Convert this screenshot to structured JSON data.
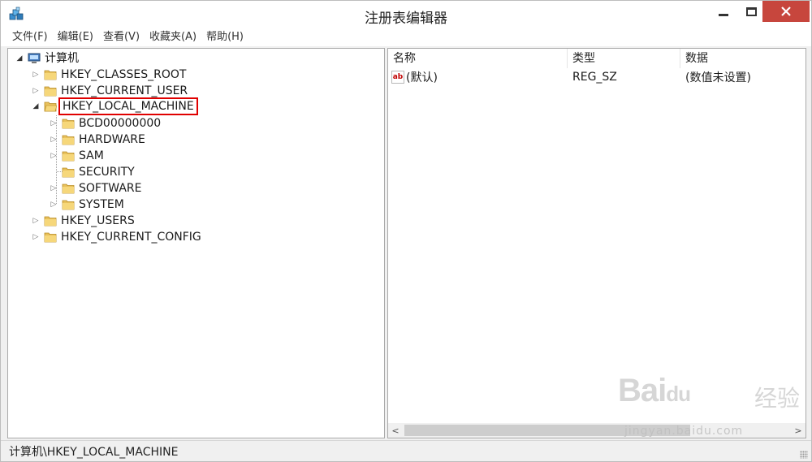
{
  "window": {
    "title": "注册表编辑器",
    "close_color": "#c7463d"
  },
  "menubar": {
    "items": [
      "文件(F)",
      "编辑(E)",
      "查看(V)",
      "收藏夹(A)",
      "帮助(H)"
    ]
  },
  "tree": {
    "root": "计算机",
    "items": [
      {
        "label": "HKEY_CLASSES_ROOT",
        "level": 1,
        "expander": "collapsed"
      },
      {
        "label": "HKEY_CURRENT_USER",
        "level": 1,
        "expander": "collapsed"
      },
      {
        "label": "HKEY_LOCAL_MACHINE",
        "level": 1,
        "expander": "expanded",
        "highlighted": true
      },
      {
        "label": "BCD00000000",
        "level": 2,
        "expander": "collapsed"
      },
      {
        "label": "HARDWARE",
        "level": 2,
        "expander": "collapsed"
      },
      {
        "label": "SAM",
        "level": 2,
        "expander": "collapsed"
      },
      {
        "label": "SECURITY",
        "level": 2,
        "expander": "none"
      },
      {
        "label": "SOFTWARE",
        "level": 2,
        "expander": "collapsed"
      },
      {
        "label": "SYSTEM",
        "level": 2,
        "expander": "collapsed"
      },
      {
        "label": "HKEY_USERS",
        "level": 1,
        "expander": "collapsed"
      },
      {
        "label": "HKEY_CURRENT_CONFIG",
        "level": 1,
        "expander": "collapsed"
      }
    ],
    "highlight_color": "#e00000"
  },
  "list": {
    "columns": [
      "名称",
      "类型",
      "数据"
    ],
    "rows": [
      {
        "name": "(默认)",
        "type": "REG_SZ",
        "data": "(数值未设置)",
        "icon": "ab"
      }
    ]
  },
  "statusbar": {
    "path": "计算机\\HKEY_LOCAL_MACHINE"
  },
  "watermark": {
    "logo": "Bai",
    "logo2": "du",
    "brand": "经验",
    "url": "jingyan.baidu.com"
  }
}
